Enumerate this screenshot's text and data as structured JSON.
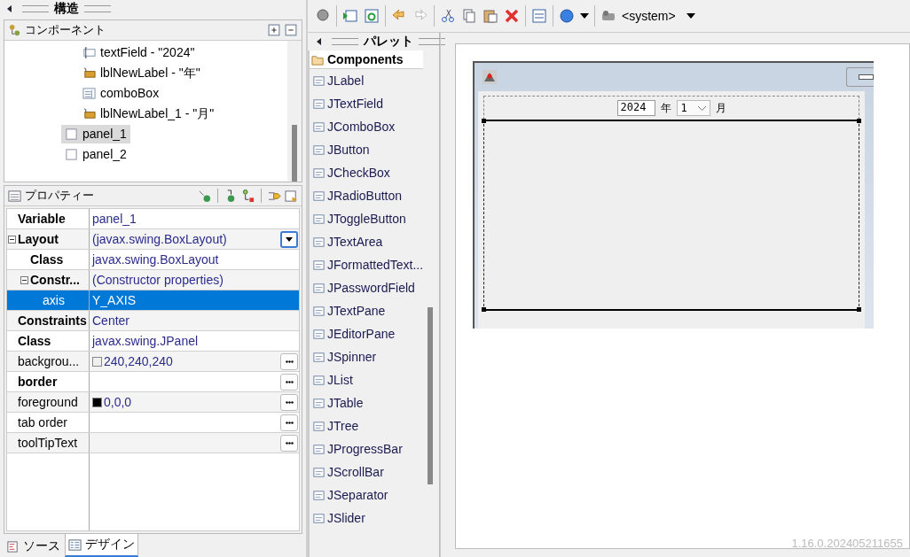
{
  "structure_header": {
    "title": "構造"
  },
  "components": {
    "title": "コンポーネント",
    "tree": [
      {
        "children": [
          {
            "label": "textField - \"2024\"",
            "kind": "field",
            "selected": false
          },
          {
            "label": "lblNewLabel - \"年\"",
            "kind": "label",
            "selected": false
          },
          {
            "label": "comboBox",
            "kind": "combo",
            "selected": false
          },
          {
            "label": "lblNewLabel_1 - \"月\"",
            "kind": "label",
            "selected": false
          }
        ]
      },
      {
        "label": "panel_1",
        "kind": "panel",
        "selected": true
      },
      {
        "label": "panel_2",
        "kind": "panel",
        "selected": false
      }
    ]
  },
  "properties": {
    "title": "プロパティー",
    "rows": [
      {
        "name": "Variable",
        "value": "panel_1",
        "bold": true,
        "selected": false
      },
      {
        "name": "Layout",
        "value": "(javax.swing.BoxLayout)",
        "bold": true,
        "selected": false,
        "expanded": true,
        "kind": "dropdown",
        "children": [
          {
            "name": "Class",
            "value": "javax.swing.BoxLayout",
            "bold": true,
            "selected": false
          },
          {
            "name": "Constr...",
            "value": "(Constructor properties)",
            "bold": true,
            "selected": false,
            "expanded": true,
            "children": [
              {
                "name": "axis",
                "value": "Y_AXIS",
                "bold": false,
                "selected": true
              }
            ]
          }
        ]
      },
      {
        "name": "Constraints",
        "value": "Center",
        "bold": true,
        "selected": false
      },
      {
        "name": "Class",
        "value": "javax.swing.JPanel",
        "bold": true,
        "selected": false
      },
      {
        "name": "backgrou...",
        "value": "240,240,240",
        "bold": false,
        "selected": false,
        "kind": "dialog",
        "color": "#f0f0f0"
      },
      {
        "name": "border",
        "value": "",
        "bold": true,
        "selected": false,
        "kind": "dialog"
      },
      {
        "name": "foreground",
        "value": "0,0,0",
        "bold": false,
        "selected": false,
        "kind": "dialog",
        "color": "#000000"
      },
      {
        "name": "tab order",
        "value": "",
        "bold": false,
        "selected": false,
        "kind": "dialog"
      },
      {
        "name": "toolTipText",
        "value": "",
        "bold": false,
        "selected": false,
        "kind": "dialog"
      }
    ]
  },
  "bottom_tabs": [
    {
      "label": "ソース",
      "selected": false
    },
    {
      "label": "デザイン",
      "selected": true
    }
  ],
  "toolbar": {
    "locale": "<system>"
  },
  "palette": {
    "title": "パレット",
    "category": "Components",
    "items": [
      "JLabel",
      "JTextField",
      "JComboBox",
      "JButton",
      "JCheckBox",
      "JRadioButton",
      "JToggleButton",
      "JTextArea",
      "JFormattedText...",
      "JPasswordField",
      "JTextPane",
      "JEditorPane",
      "JSpinner",
      "JList",
      "JTable",
      "JTree",
      "JProgressBar",
      "JScrollBar",
      "JSeparator",
      "JSlider"
    ]
  },
  "form": {
    "year_field": "2024",
    "year_label": "年",
    "month_combo": "1",
    "month_label": "月"
  },
  "version": "1.16.0.202405211655"
}
